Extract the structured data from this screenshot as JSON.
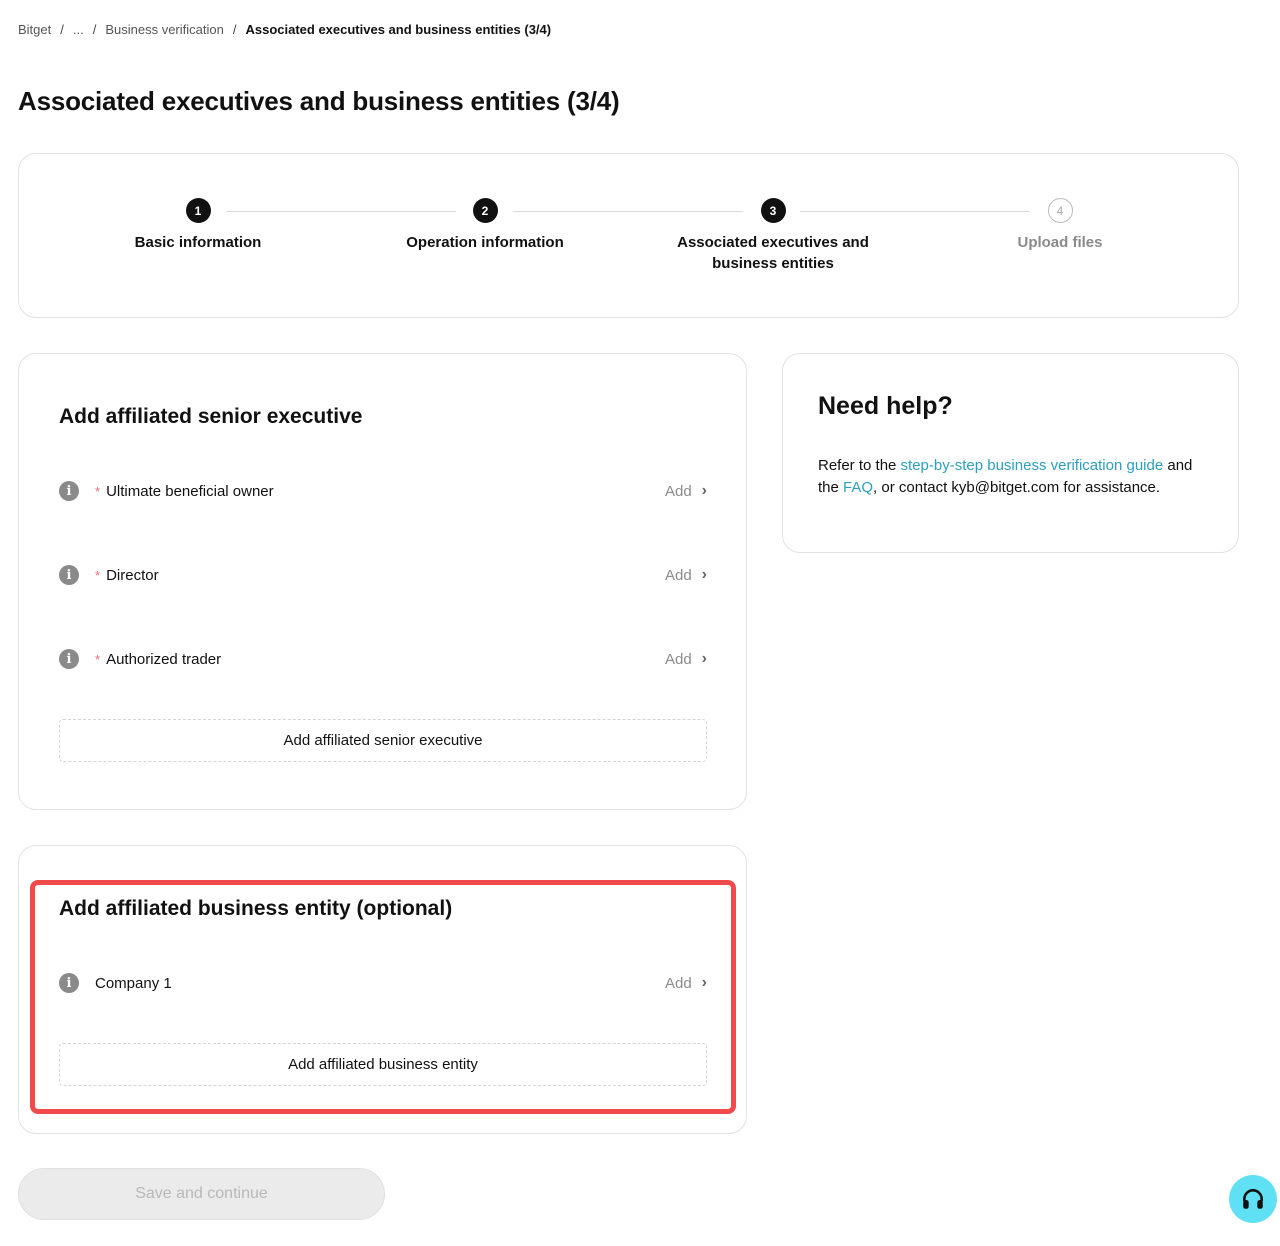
{
  "breadcrumb": {
    "items": [
      "Bitget",
      "...",
      "Business verification"
    ],
    "current": "Associated executives and business entities (3/4)",
    "separator": "/"
  },
  "page_title": "Associated executives and business entities (3/4)",
  "stepper": {
    "steps": [
      {
        "number": "1",
        "label": "Basic information",
        "status": "done"
      },
      {
        "number": "2",
        "label": "Operation information",
        "status": "done"
      },
      {
        "number": "3",
        "label": "Associated executives and business entities",
        "status": "active"
      },
      {
        "number": "4",
        "label": "Upload files",
        "status": "pending"
      }
    ]
  },
  "executives": {
    "title": "Add affiliated senior executive",
    "rows": [
      {
        "label": "Ultimate beneficial owner",
        "required": "*",
        "action": "Add"
      },
      {
        "label": "Director",
        "required": "*",
        "action": "Add"
      },
      {
        "label": "Authorized trader",
        "required": "*",
        "action": "Add"
      }
    ],
    "add_button": "Add affiliated senior executive"
  },
  "entities": {
    "title": "Add affiliated business entity (optional)",
    "rows": [
      {
        "label": "Company 1",
        "action": "Add"
      }
    ],
    "add_button": "Add affiliated business entity"
  },
  "help": {
    "title": "Need help?",
    "text_prefix": "Refer to the ",
    "guide_link": "step-by-step business verification guide",
    "text_middle": " and the ",
    "faq_link": "FAQ",
    "text_suffix": ", or contact kyb@bitget.com for assistance."
  },
  "save_button": "Save and continue",
  "colors": {
    "accent_link": "#2b9fbd",
    "highlight": "#f04a4a",
    "support": "#5fe0f5",
    "required": "#e86a7a"
  },
  "icons": {
    "info": "info-icon",
    "chevron": "chevron-right-icon",
    "support": "headset-icon"
  }
}
